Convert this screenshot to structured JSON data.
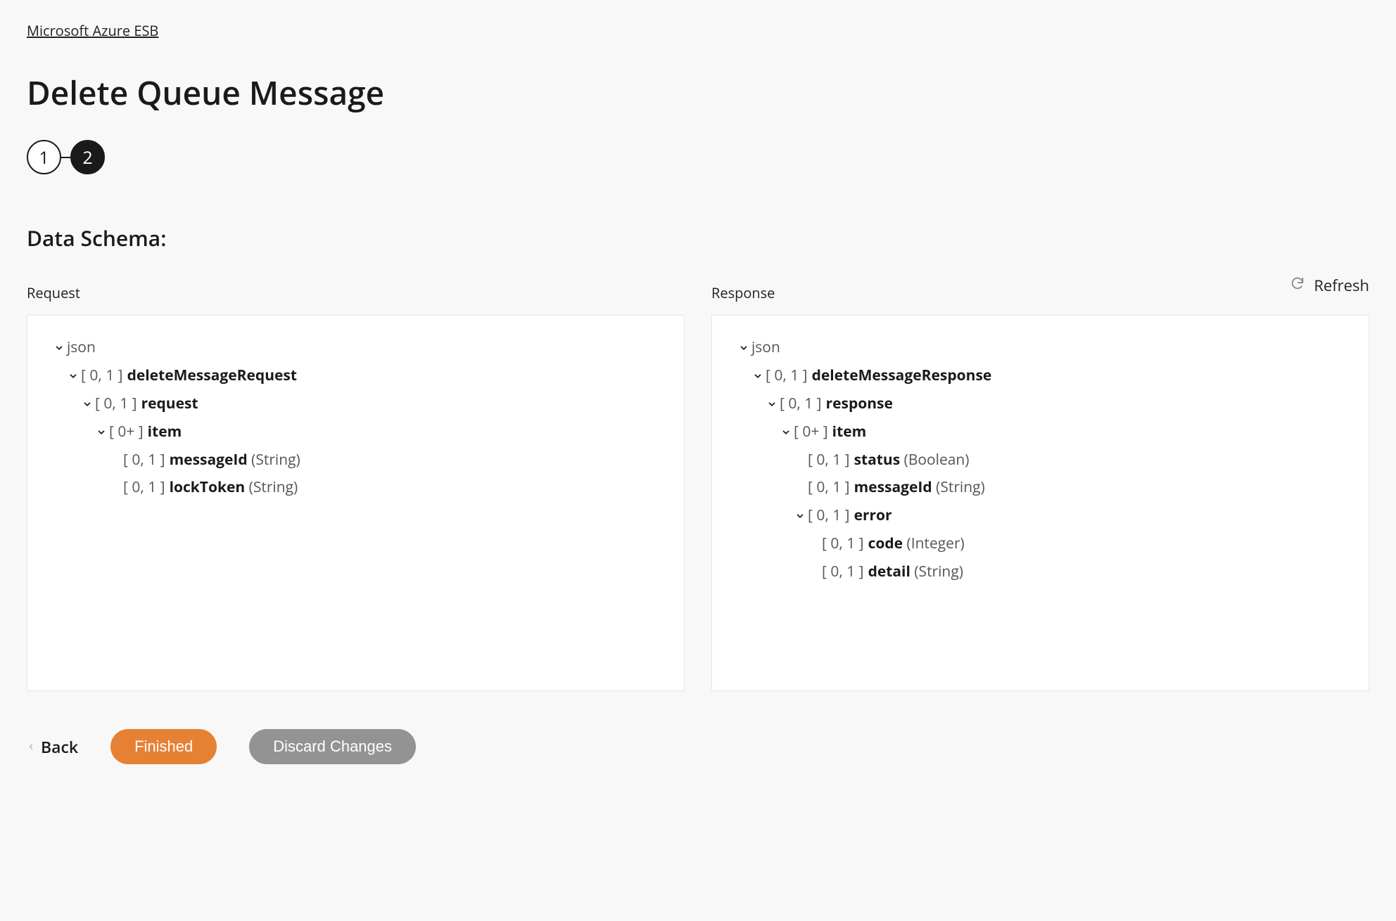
{
  "breadcrumb": "Microsoft Azure ESB",
  "title": "Delete Queue Message",
  "stepper": {
    "step1": "1",
    "step2": "2"
  },
  "section_heading": "Data Schema:",
  "refresh": {
    "label": "Refresh"
  },
  "request": {
    "label": "Request",
    "root": "json",
    "l1": {
      "card": "[ 0, 1 ]",
      "name": "deleteMessageRequest"
    },
    "l2": {
      "card": "[ 0, 1 ]",
      "name": "request"
    },
    "l3": {
      "card": "[ 0+ ]",
      "name": "item"
    },
    "f1": {
      "card": "[ 0, 1 ]",
      "name": "messageId",
      "type": "(String)"
    },
    "f2": {
      "card": "[ 0, 1 ]",
      "name": "lockToken",
      "type": "(String)"
    }
  },
  "response": {
    "label": "Response",
    "root": "json",
    "l1": {
      "card": "[ 0, 1 ]",
      "name": "deleteMessageResponse"
    },
    "l2": {
      "card": "[ 0, 1 ]",
      "name": "response"
    },
    "l3": {
      "card": "[ 0+ ]",
      "name": "item"
    },
    "f1": {
      "card": "[ 0, 1 ]",
      "name": "status",
      "type": "(Boolean)"
    },
    "f2": {
      "card": "[ 0, 1 ]",
      "name": "messageId",
      "type": "(String)"
    },
    "l4": {
      "card": "[ 0, 1 ]",
      "name": "error"
    },
    "f3": {
      "card": "[ 0, 1 ]",
      "name": "code",
      "type": "(Integer)"
    },
    "f4": {
      "card": "[ 0, 1 ]",
      "name": "detail",
      "type": "(String)"
    }
  },
  "footer": {
    "back": "Back",
    "finished": "Finished",
    "discard": "Discard Changes"
  }
}
